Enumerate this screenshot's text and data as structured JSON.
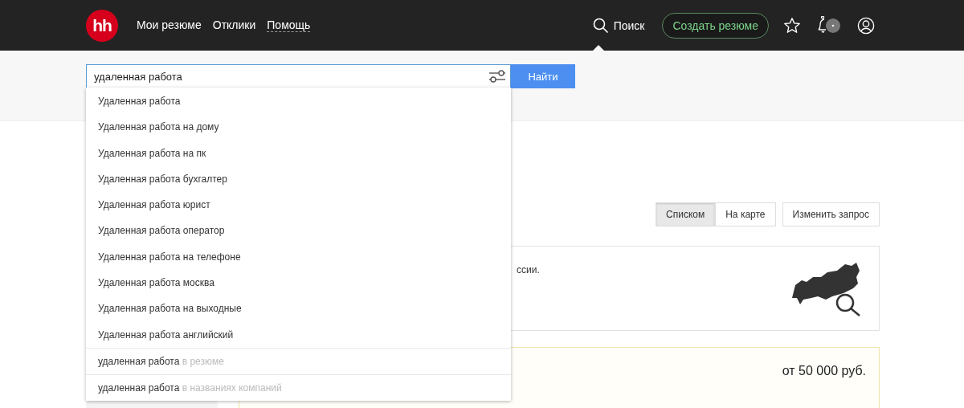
{
  "header": {
    "nav": [
      {
        "label": "Мои резюме",
        "kind": "plain"
      },
      {
        "label": "Отклики",
        "kind": "plain"
      },
      {
        "label": "Помощь",
        "kind": "dotted"
      }
    ],
    "logo": "hh",
    "search_link": "Поиск",
    "create_button": "Создать резюме"
  },
  "search": {
    "value": "удаленная работа",
    "button": "Найти"
  },
  "suggestions": [
    {
      "text": "Удаленная работа"
    },
    {
      "text": "Удаленная работа на дому"
    },
    {
      "text": "Удаленная работа на пк"
    },
    {
      "text": "Удаленная работа бухгалтер"
    },
    {
      "text": "Удаленная работа юрист"
    },
    {
      "text": "Удаленная работа оператор"
    },
    {
      "text": "Удаленная работа на телефоне"
    },
    {
      "text": "Удаленная работа москва"
    },
    {
      "text": "Удаленная работа на выходные"
    },
    {
      "text": "Удаленная работа английский"
    }
  ],
  "scoped": [
    {
      "query": "удаленная работа",
      "scope": "в резюме"
    },
    {
      "query": "удаленная работа",
      "scope": "в названиях компаний"
    }
  ],
  "view_tabs": [
    {
      "label": "Списком",
      "selected": true
    },
    {
      "label": "На карте",
      "selected": false
    }
  ],
  "edit_button": "Изменить запрос",
  "map_card": {
    "text": "ссии."
  },
  "vacancy": {
    "salary": "от 50 000 руб."
  }
}
